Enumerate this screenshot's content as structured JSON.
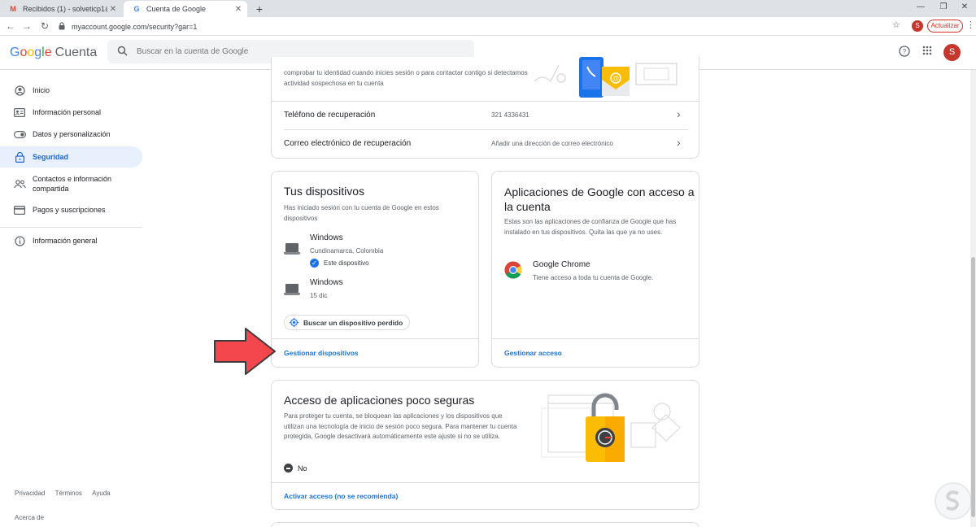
{
  "browser": {
    "tabs": [
      {
        "title": "Recibidos (1) - solveticp1@gmail",
        "favicon": "gmail-icon"
      },
      {
        "title": "Cuenta de Google",
        "favicon": "google-icon"
      }
    ],
    "url": "myaccount.google.com/security?gar=1",
    "update_label": "Actualizar",
    "profile_initial": "S"
  },
  "header": {
    "logo_letters": [
      "G",
      "o",
      "o",
      "g",
      "l",
      "e"
    ],
    "product": "Cuenta",
    "search_placeholder": "Buscar en la cuenta de Google",
    "avatar_initial": "S"
  },
  "sidebar": {
    "items": [
      {
        "label": "Inicio",
        "icon": "account-circle-icon"
      },
      {
        "label": "Información personal",
        "icon": "id-card-icon"
      },
      {
        "label": "Datos y personalización",
        "icon": "toggle-icon"
      },
      {
        "label": "Seguridad",
        "icon": "lock-icon",
        "active": true
      },
      {
        "label": "Contactos e información compartida",
        "icon": "people-icon"
      },
      {
        "label": "Pagos y suscripciones",
        "icon": "credit-card-icon"
      },
      {
        "label": "Información general",
        "icon": "info-icon"
      }
    ],
    "footer": {
      "privacy": "Privacidad",
      "terms": "Términos",
      "help": "Ayuda",
      "about": "Acerca de"
    }
  },
  "recovery": {
    "desc": "comprobar tu identidad cuando inicies sesión o para contactar contigo si detectamos actividad sospechosa en tu cuenta",
    "rows": [
      {
        "label": "Teléfono de recuperación",
        "value": "321 4336431"
      },
      {
        "label": "Correo electrónico de recuperación",
        "value": "Añadir una dirección de correo electrónico"
      }
    ]
  },
  "devices": {
    "title": "Tus dispositivos",
    "desc": "Has iniciado sesión con tu cuenta de Google en estos dispositivos",
    "items": [
      {
        "name": "Windows",
        "detail": "Cundinamarca, Colombia",
        "badge": "Este dispositivo"
      },
      {
        "name": "Windows",
        "detail": "15 dic"
      }
    ],
    "find_button": "Buscar un dispositivo perdido",
    "manage_link": "Gestionar dispositivos"
  },
  "apps": {
    "title": "Aplicaciones de Google con acceso a la cuenta",
    "desc": "Estas son las aplicaciones de confianza de Google que has instalado en tus dispositivos. Quita las que ya no uses.",
    "items": [
      {
        "name": "Google Chrome",
        "detail": "Tiene acceso a toda tu cuenta de Google."
      }
    ],
    "manage_link": "Gestionar acceso"
  },
  "less_secure": {
    "title": "Acceso de aplicaciones poco seguras",
    "desc": "Para proteger tu cuenta, se bloquean las aplicaciones y los dispositivos que utilizan una tecnología de inicio de sesión poco segura. Para mantener tu cuenta protegida, Google desactivará automáticamente este ajuste si no se utiliza.",
    "status": "No",
    "activate_link": "Activar acceso (no se recomienda)"
  },
  "colors": {
    "accent": "#1a73e8",
    "active_bg": "#e8f0fe",
    "arrow": "#f4474d"
  }
}
